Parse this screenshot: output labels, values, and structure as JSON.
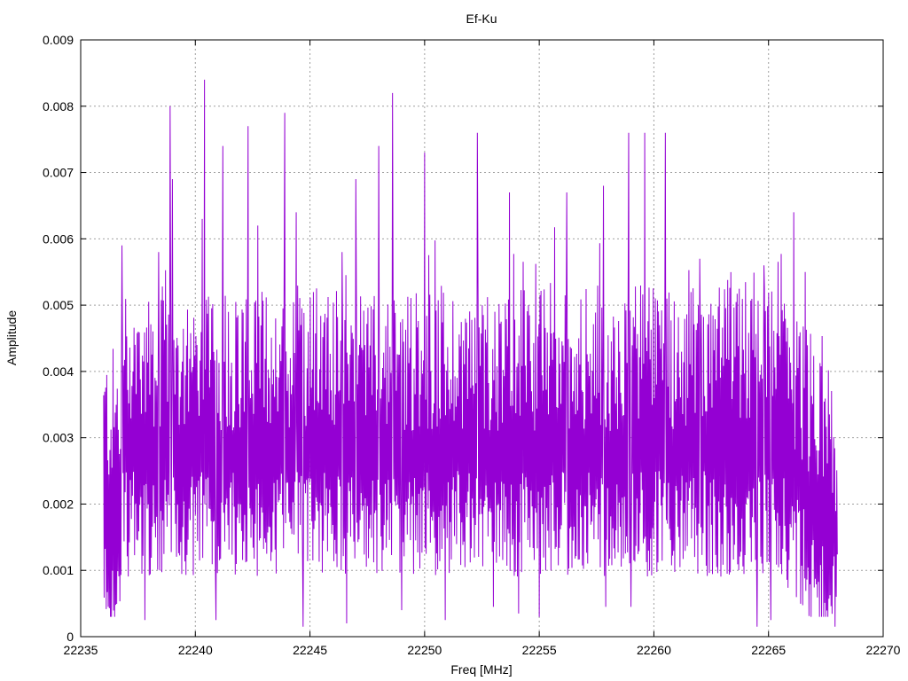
{
  "chart_data": {
    "type": "line",
    "title": "Ef-Ku",
    "xlabel": "Freq [MHz]",
    "ylabel": "Amplitude",
    "xlim": [
      22235,
      22270
    ],
    "ylim": [
      0,
      0.009
    ],
    "xticks": [
      "22235",
      "22240",
      "22245",
      "22250",
      "22255",
      "22260",
      "22265",
      "22270"
    ],
    "yticks": [
      "0",
      "0.001",
      "0.002",
      "0.003",
      "0.004",
      "0.005",
      "0.006",
      "0.007",
      "0.008",
      "0.009"
    ],
    "grid": true,
    "legend": "none",
    "series": [
      {
        "color": "#9400d3",
        "x_start": 22236.0,
        "x_end": 22268.0,
        "peaks": [
          [
            22236.8,
            0.0059
          ],
          [
            22238.4,
            0.0058
          ],
          [
            22238.9,
            0.008
          ],
          [
            22239.0,
            0.0069
          ],
          [
            22240.4,
            0.0084
          ],
          [
            22240.3,
            0.0063
          ],
          [
            22241.2,
            0.0074
          ],
          [
            22242.3,
            0.0077
          ],
          [
            22243.9,
            0.0079
          ],
          [
            22244.4,
            0.0064
          ],
          [
            22246.4,
            0.0058
          ],
          [
            22247.0,
            0.0069
          ],
          [
            22248.0,
            0.0074
          ],
          [
            22248.6,
            0.0082
          ],
          [
            22250.0,
            0.0073
          ],
          [
            22252.3,
            0.0076
          ],
          [
            22253.7,
            0.0067
          ],
          [
            22256.2,
            0.0067
          ],
          [
            22257.8,
            0.0068
          ],
          [
            22258.9,
            0.0076
          ],
          [
            22259.6,
            0.0076
          ],
          [
            22260.5,
            0.0076
          ],
          [
            22262.0,
            0.0057
          ],
          [
            22264.8,
            0.0056
          ],
          [
            22266.1,
            0.0064
          ],
          [
            22266.6,
            0.0055
          ]
        ],
        "dips": [
          [
            22236.2,
            0.00045
          ],
          [
            22237.8,
            0.00025
          ],
          [
            22240.9,
            0.00025
          ],
          [
            22244.7,
            0.00015
          ],
          [
            22246.6,
            0.0002
          ],
          [
            22249.0,
            0.0004
          ],
          [
            22250.9,
            0.00025
          ],
          [
            22253.0,
            0.00045
          ],
          [
            22254.1,
            0.00035
          ],
          [
            22255.0,
            0.0003
          ],
          [
            22257.9,
            0.00045
          ],
          [
            22259.0,
            0.00045
          ],
          [
            22264.5,
            0.00015
          ],
          [
            22265.1,
            0.00025
          ],
          [
            22267.9,
            0.00015
          ]
        ]
      }
    ]
  }
}
